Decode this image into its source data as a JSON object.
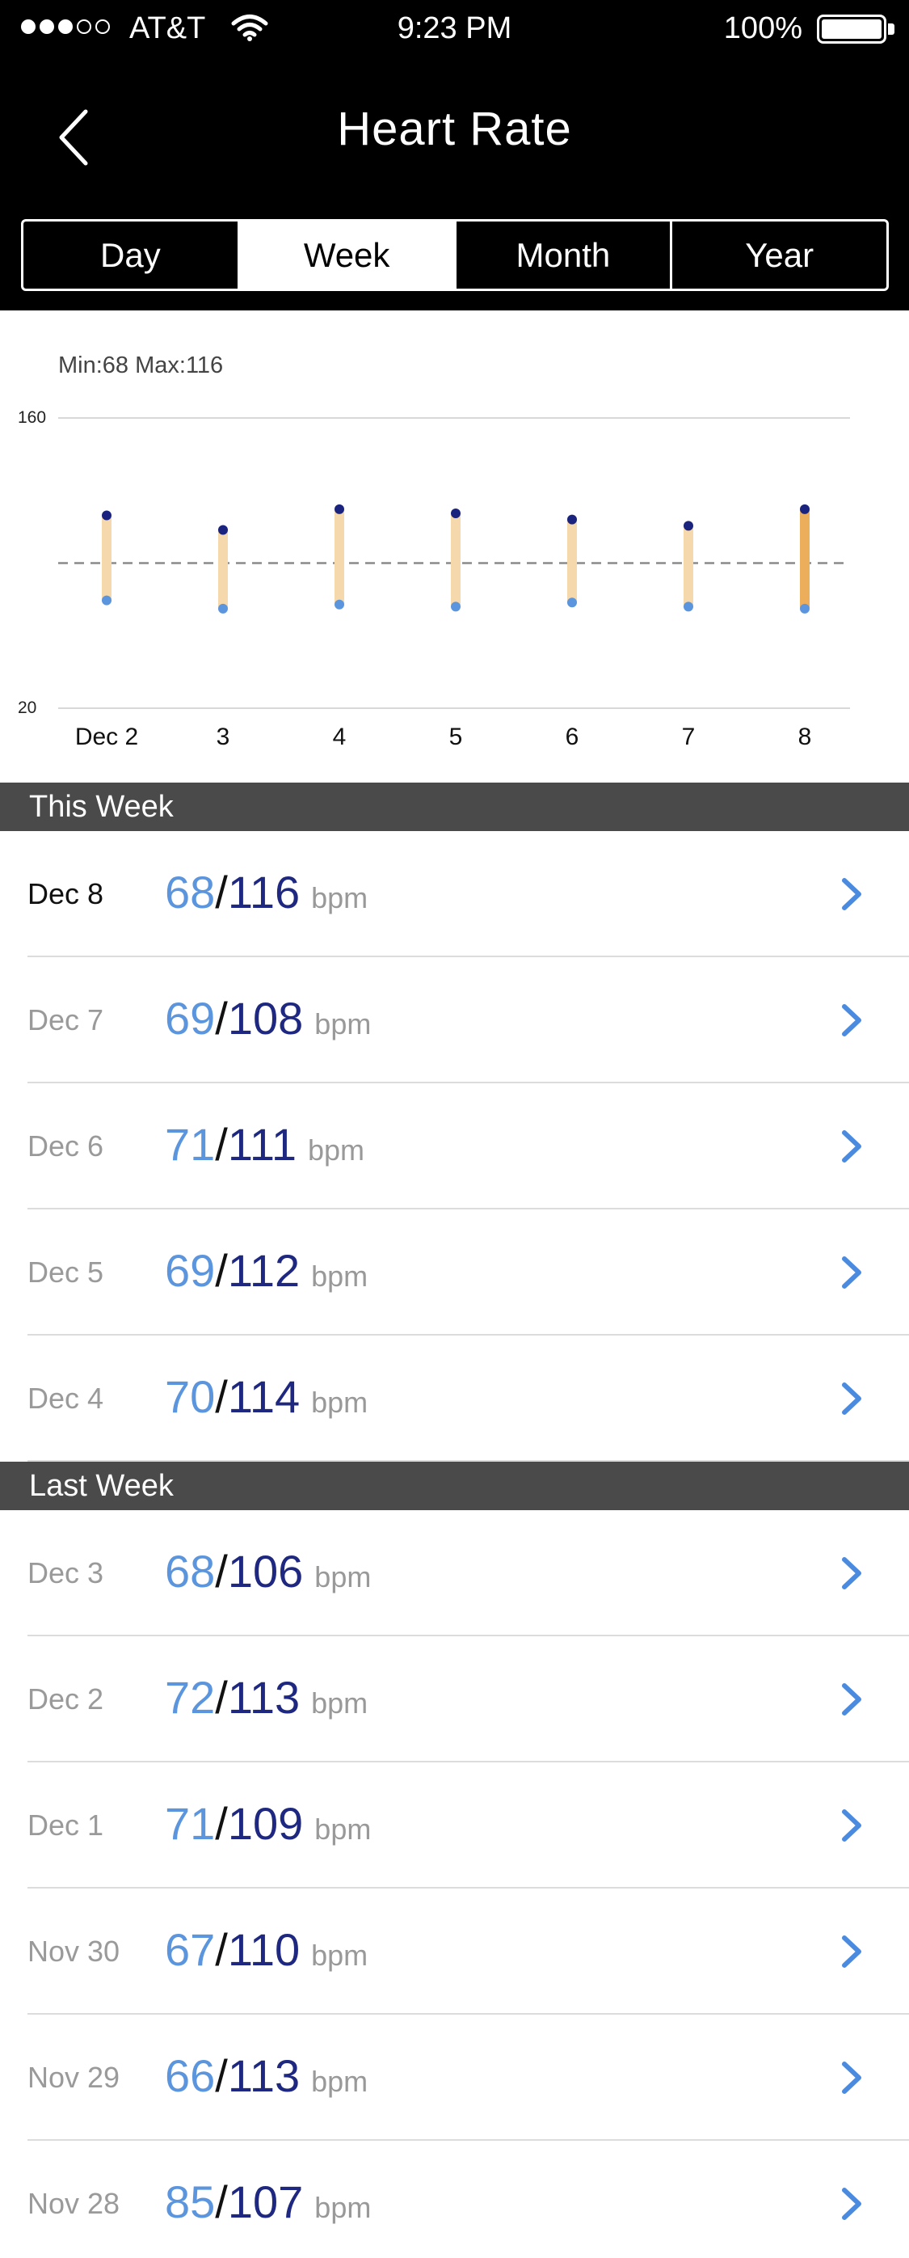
{
  "status_bar": {
    "carrier": "AT&T",
    "time": "9:23 PM",
    "battery": "100%"
  },
  "nav": {
    "title": "Heart Rate",
    "back_icon": "chevron-left-icon"
  },
  "segments": [
    {
      "label": "Day",
      "active": false
    },
    {
      "label": "Week",
      "active": true
    },
    {
      "label": "Month",
      "active": false
    },
    {
      "label": "Year",
      "active": false
    }
  ],
  "summary": "Min:68 Max:116",
  "chart_data": {
    "type": "range-bar",
    "categories": [
      "Dec 2",
      "3",
      "4",
      "5",
      "6",
      "7",
      "8"
    ],
    "min": [
      72,
      68,
      70,
      69,
      71,
      69,
      68
    ],
    "max": [
      113,
      106,
      116,
      114,
      111,
      108,
      116
    ],
    "ylim": [
      20,
      160
    ],
    "yticks": [
      160,
      20
    ],
    "reference_line": 90,
    "highlight_index": 6,
    "colors": {
      "bar": "#f5d9ad",
      "bar_highlight": "#edae5c",
      "max_dot": "#1a237e",
      "min_dot": "#5b95dd"
    }
  },
  "sections": [
    {
      "title": "This Week",
      "rows": [
        {
          "date": "Dec 8",
          "min": "68",
          "max": "116",
          "unit": "bpm",
          "current": true
        },
        {
          "date": "Dec 7",
          "min": "69",
          "max": "108",
          "unit": "bpm"
        },
        {
          "date": "Dec 6",
          "min": "71",
          "max": "111",
          "unit": "bpm"
        },
        {
          "date": "Dec 5",
          "min": "69",
          "max": "112",
          "unit": "bpm"
        },
        {
          "date": "Dec 4",
          "min": "70",
          "max": "114",
          "unit": "bpm"
        }
      ]
    },
    {
      "title": "Last Week",
      "rows": [
        {
          "date": "Dec 3",
          "min": "68",
          "max": "106",
          "unit": "bpm"
        },
        {
          "date": "Dec 2",
          "min": "72",
          "max": "113",
          "unit": "bpm"
        },
        {
          "date": "Dec 1",
          "min": "71",
          "max": "109",
          "unit": "bpm"
        },
        {
          "date": "Nov 30",
          "min": "67",
          "max": "110",
          "unit": "bpm"
        },
        {
          "date": "Nov 29",
          "min": "66",
          "max": "113",
          "unit": "bpm"
        },
        {
          "date": "Nov 28",
          "min": "85",
          "max": "107",
          "unit": "bpm"
        }
      ]
    }
  ]
}
